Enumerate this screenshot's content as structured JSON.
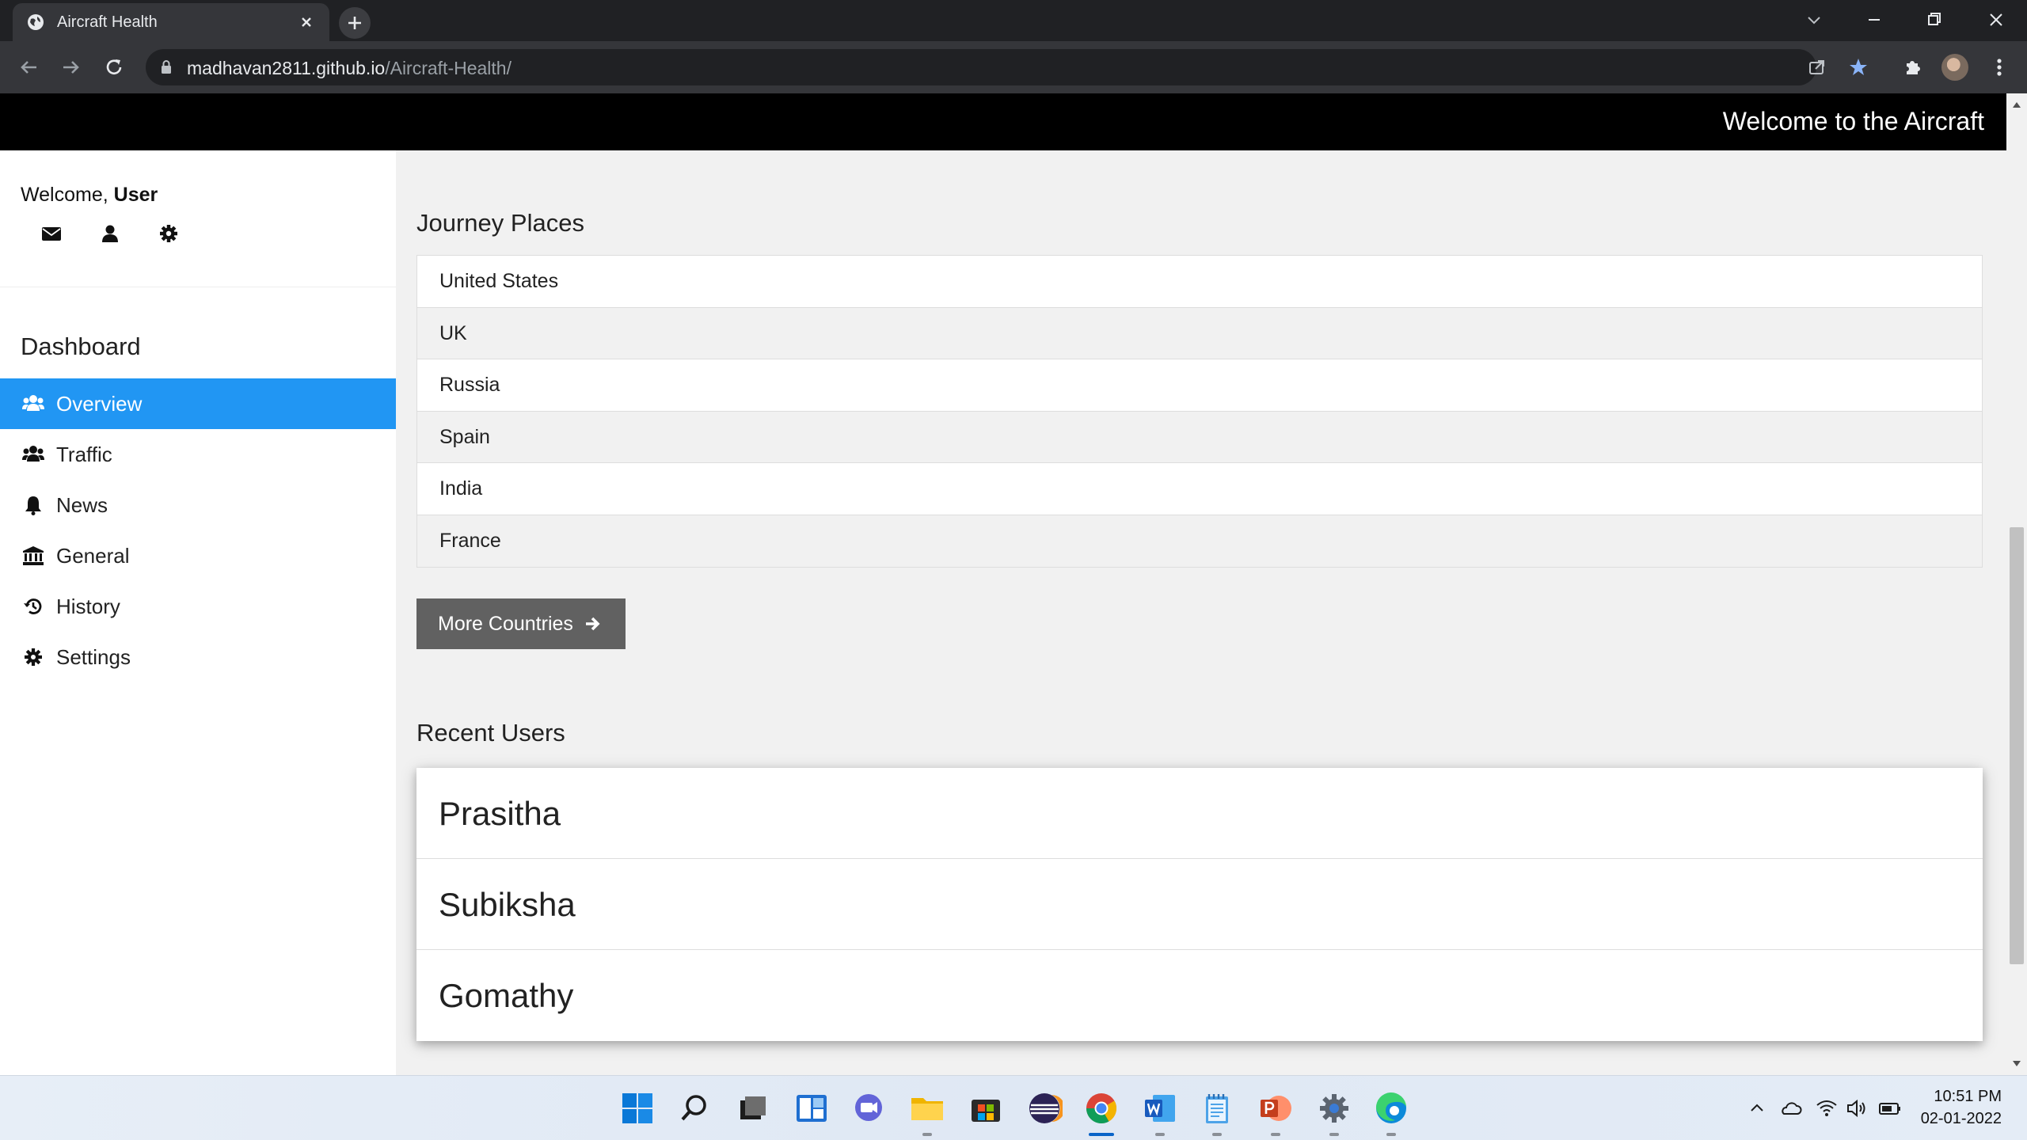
{
  "browser": {
    "tab_title": "Aircraft Health",
    "url_host": "madhavan2811.github.io",
    "url_path": "/Aircraft-Health/"
  },
  "header": {
    "welcome_text": "Welcome to the Aircraft"
  },
  "sidebar": {
    "welcome_prefix": "Welcome, ",
    "user_name": "User",
    "icons": [
      "envelope-icon",
      "user-icon",
      "gear-icon"
    ],
    "dashboard_title": "Dashboard",
    "nav_items": [
      {
        "label": "Overview",
        "icon": "users-icon",
        "active": true
      },
      {
        "label": "Traffic",
        "icon": "users-icon",
        "active": false
      },
      {
        "label": "News",
        "icon": "bell-icon",
        "active": false
      },
      {
        "label": "General",
        "icon": "bank-icon",
        "active": false
      },
      {
        "label": "History",
        "icon": "history-icon",
        "active": false
      },
      {
        "label": "Settings",
        "icon": "gear-icon",
        "active": false
      }
    ]
  },
  "journey": {
    "title": "Journey Places",
    "places": [
      "United States",
      "UK",
      "Russia",
      "Spain",
      "India",
      "France"
    ],
    "more_button": "More Countries"
  },
  "recent_users": {
    "title": "Recent Users",
    "users": [
      "Prasitha",
      "Subiksha",
      "Gomathy"
    ]
  },
  "taskbar": {
    "time": "10:51 PM",
    "date": "02-01-2022"
  },
  "colors": {
    "accent": "#2196f3",
    "topbar": "#000000",
    "button": "#616161"
  }
}
